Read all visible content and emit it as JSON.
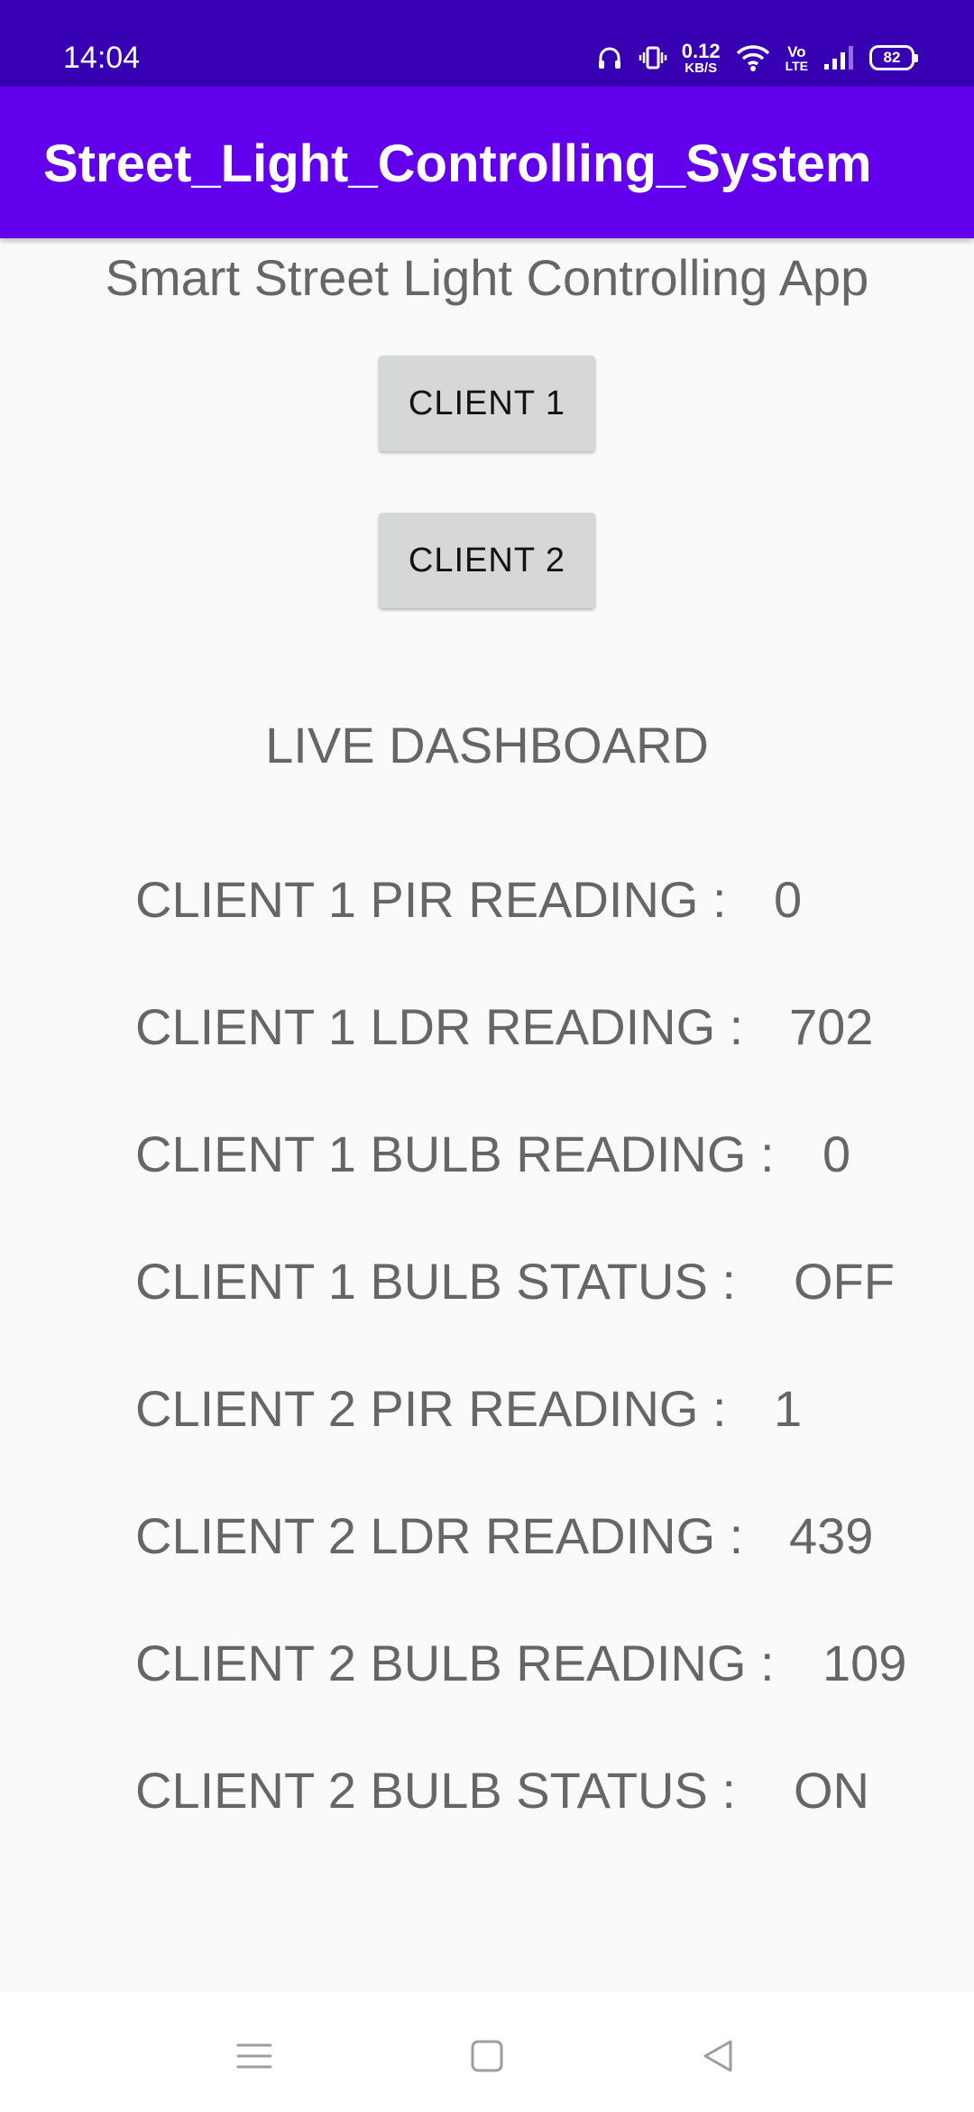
{
  "status_bar": {
    "time": "14:04",
    "net_speed_value": "0.12",
    "net_speed_unit": "KB/S",
    "volte_top": "Vo",
    "volte_bottom": "LTE",
    "battery": "82",
    "icons": [
      "headphones-icon",
      "vibrate-icon",
      "wifi-icon",
      "volte-icon",
      "signal-icon",
      "battery-icon"
    ]
  },
  "app_bar": {
    "title": "Street_Light_Controlling_System"
  },
  "main": {
    "subtitle": "Smart Street Light Controlling App",
    "buttons": [
      {
        "label": "CLIENT 1"
      },
      {
        "label": "CLIENT 2"
      }
    ],
    "dashboard_title": "LIVE DASHBOARD",
    "readings": [
      {
        "label": "CLIENT 1 PIR READING :",
        "value": "0"
      },
      {
        "label": "CLIENT 1 LDR READING :",
        "value": "702"
      },
      {
        "label": "CLIENT 1 BULB READING :",
        "value": "0"
      },
      {
        "label": "CLIENT 1 BULB STATUS :",
        "value": "OFF"
      },
      {
        "label": "CLIENT 2 PIR READING :",
        "value": "1"
      },
      {
        "label": "CLIENT 2 LDR READING :",
        "value": "439"
      },
      {
        "label": "CLIENT 2 BULB READING :",
        "value": "109"
      },
      {
        "label": "CLIENT 2 BULB STATUS :",
        "value": "ON"
      }
    ]
  },
  "nav_bar": {
    "icons": [
      "menu-icon",
      "home-icon",
      "back-icon"
    ]
  },
  "colors": {
    "status_bar": "#3700b3",
    "app_bar": "#6200ee",
    "background": "#fafafa",
    "button": "#d6d7d7",
    "text": "#666666"
  }
}
